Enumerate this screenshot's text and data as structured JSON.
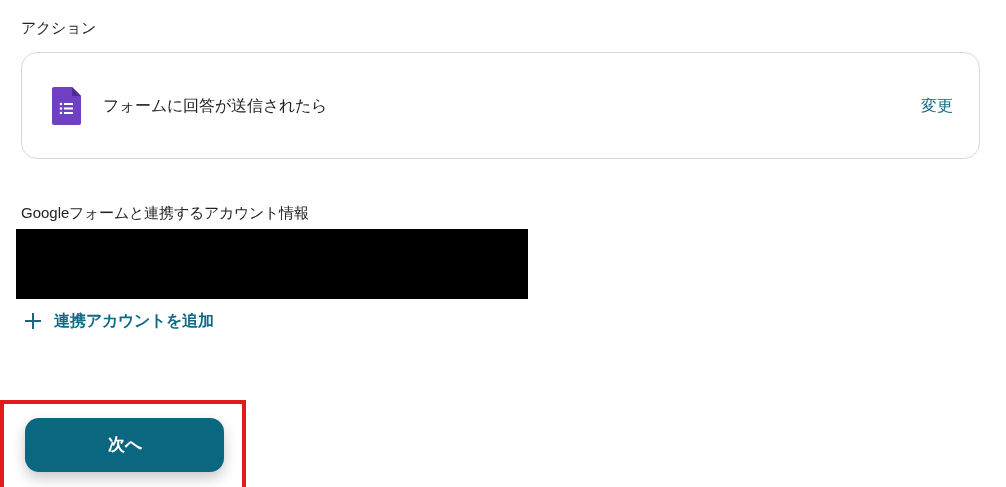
{
  "action_section": {
    "heading": "アクション",
    "trigger": {
      "label": "フォームに回答が送信されたら",
      "change_link": "変更"
    }
  },
  "account_section": {
    "heading": "Googleフォームと連携するアカウント情報",
    "add_link": "連携アカウントを追加"
  },
  "next_button": {
    "label": "次へ",
    "highlighted": true
  }
}
